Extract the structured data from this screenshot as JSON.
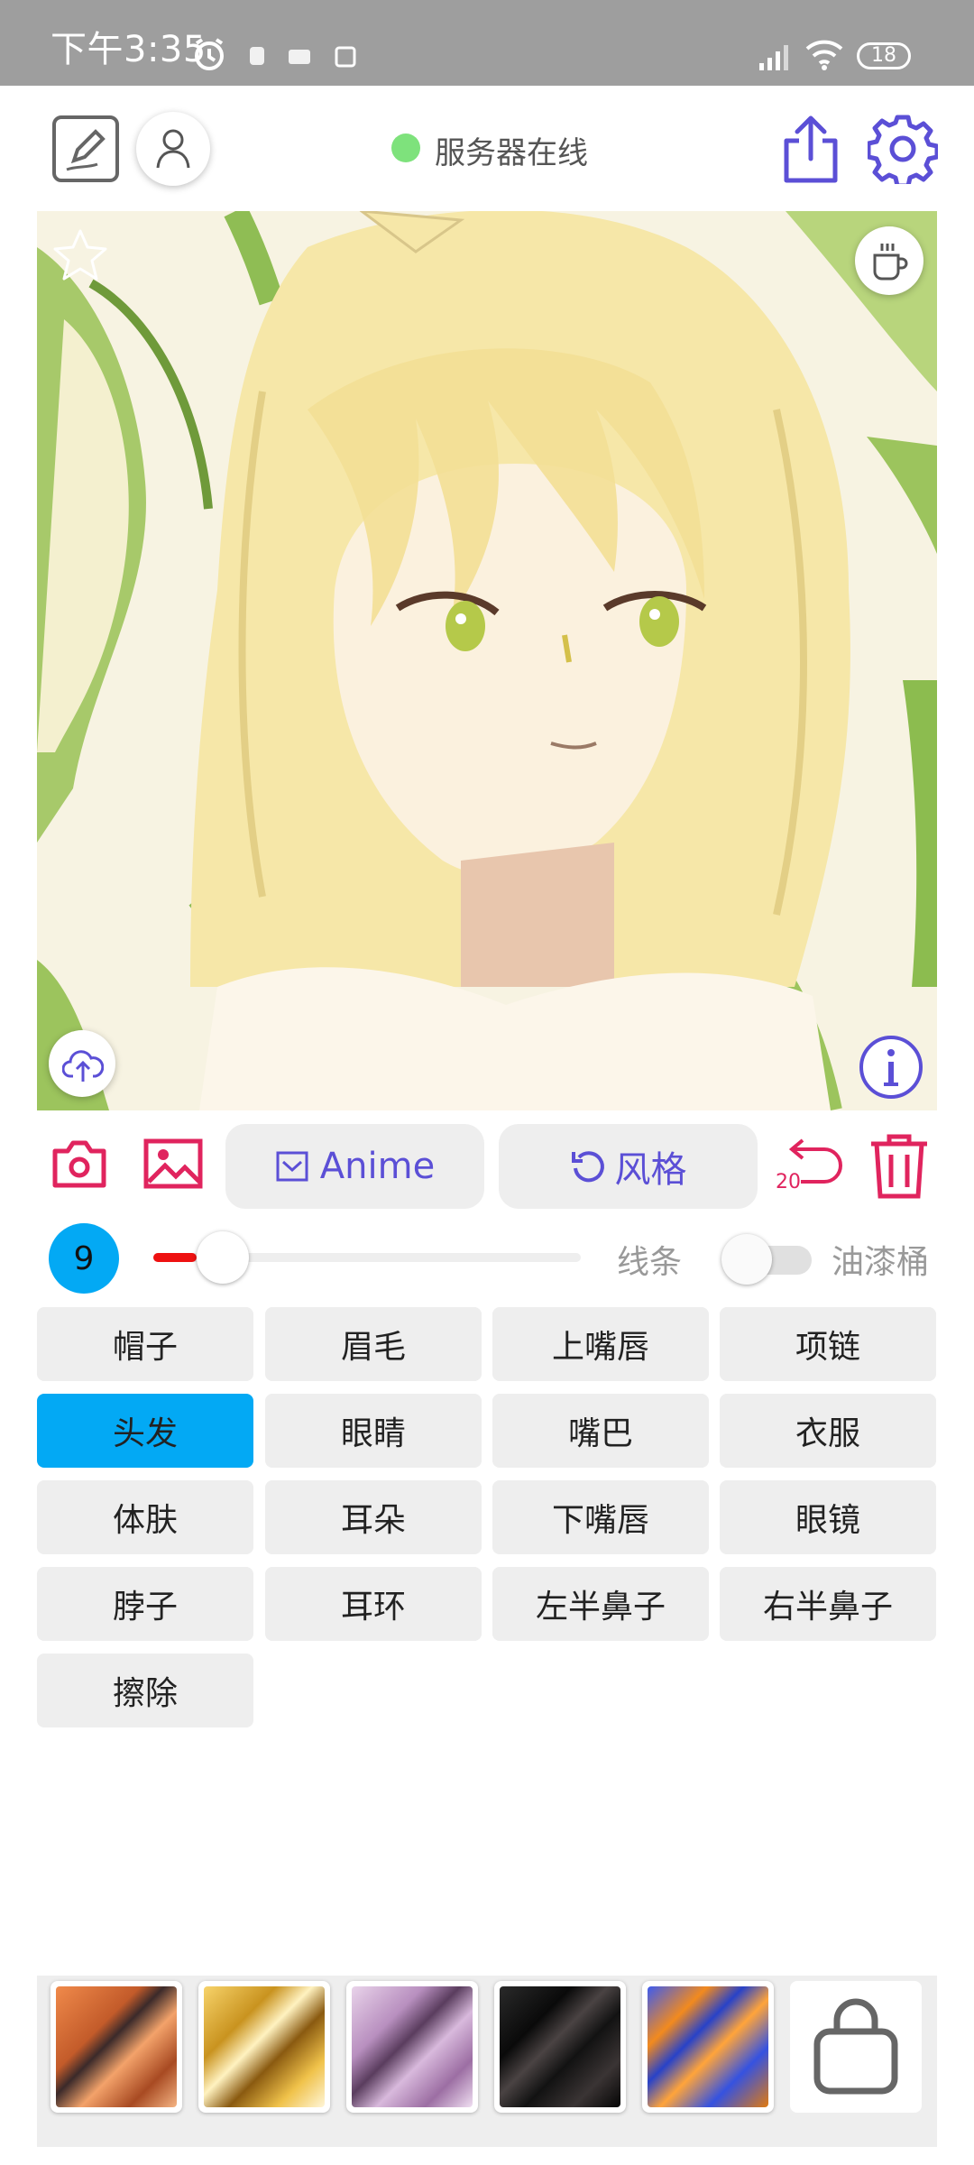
{
  "status_bar": {
    "time": "下午3:35",
    "battery": "18"
  },
  "header": {
    "server_status": "服务器在线",
    "server_status_color": "#7ee27c"
  },
  "toolbar": {
    "anime_label": "Anime",
    "style_label": "风格",
    "undo_count": "20"
  },
  "controls": {
    "brush_size": "9",
    "brush_level": 0.08,
    "line_label": "线条",
    "bucket_label": "油漆桶"
  },
  "parts": [
    "帽子",
    "眉毛",
    "上嘴唇",
    "项链",
    "头发",
    "眼睛",
    "嘴巴",
    "衣服",
    "体肤",
    "耳朵",
    "下嘴唇",
    "眼镜",
    "脖子",
    "耳环",
    "左半鼻子",
    "右半鼻子",
    "擦除"
  ],
  "selected_part": "头发",
  "colors": {
    "accent": "#5b4fd6",
    "danger": "#e0245e",
    "selected": "#03a9f4"
  },
  "swatches": [
    "orange-texture",
    "gold-texture",
    "lilac-texture",
    "black-texture",
    "blue-orange-texture"
  ]
}
